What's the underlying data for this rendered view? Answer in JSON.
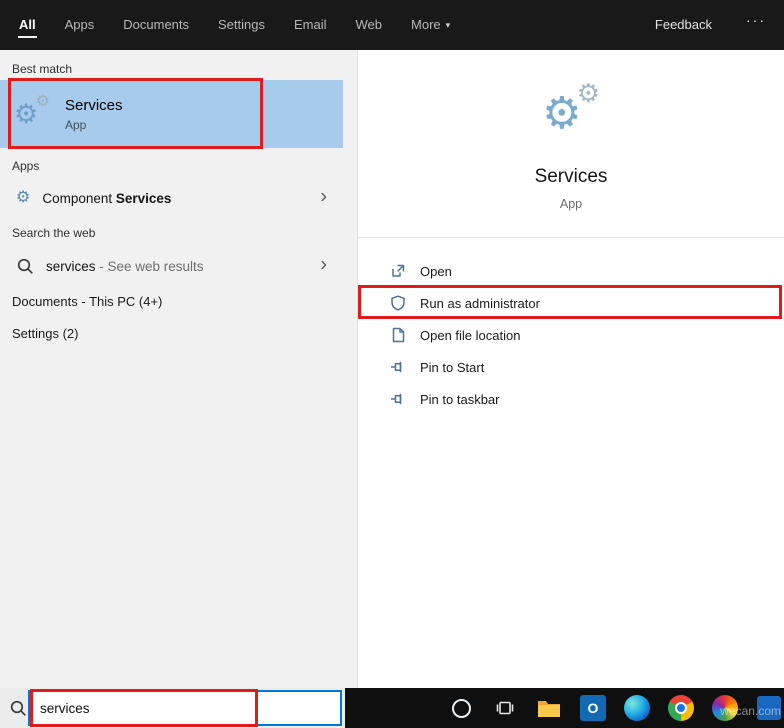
{
  "header": {
    "tabs": [
      {
        "label": "All",
        "active": true
      },
      {
        "label": "Apps",
        "active": false
      },
      {
        "label": "Documents",
        "active": false
      },
      {
        "label": "Settings",
        "active": false
      },
      {
        "label": "Email",
        "active": false
      },
      {
        "label": "Web",
        "active": false
      },
      {
        "label": "More",
        "active": false
      }
    ],
    "feedback_label": "Feedback"
  },
  "icons": {
    "gear": "⚙",
    "chevron_right": "›",
    "caret_down": "▾",
    "ellipsis": "···",
    "outlook_letter": "O"
  },
  "left_panel": {
    "best_match_header": "Best match",
    "best_match": {
      "title": "Services",
      "subtitle": "App"
    },
    "apps_header": "Apps",
    "component_services": {
      "prefix": "Component ",
      "match": "Services"
    },
    "web_header": "Search the web",
    "web_row": {
      "query": "services",
      "suffix": " - See web results"
    },
    "documents_header": "Documents - This PC (4+)",
    "settings_header": "Settings (2)"
  },
  "detail_panel": {
    "title": "Services",
    "subtitle": "App",
    "actions": [
      {
        "label": "Open",
        "highlighted": false
      },
      {
        "label": "Run as administrator",
        "highlighted": true
      },
      {
        "label": "Open file location",
        "highlighted": false
      },
      {
        "label": "Pin to Start",
        "highlighted": false
      },
      {
        "label": "Pin to taskbar",
        "highlighted": false
      }
    ]
  },
  "search_bar": {
    "value": "services"
  },
  "taskbar": {
    "icons": [
      "cortana-icon",
      "task-view-icon",
      "file-explorer-icon",
      "outlook-icon",
      "edge-icon",
      "chrome-icon",
      "colorful-orb-app-icon",
      "blue-app-icon"
    ],
    "watermark": "wecan.com"
  },
  "colors": {
    "accent": "#0078d7",
    "annotation_red": "#e11a1a",
    "selection_blue": "#a6cbec",
    "topbar_bg": "#191919",
    "taskbar_bg": "#0f0f0f"
  }
}
